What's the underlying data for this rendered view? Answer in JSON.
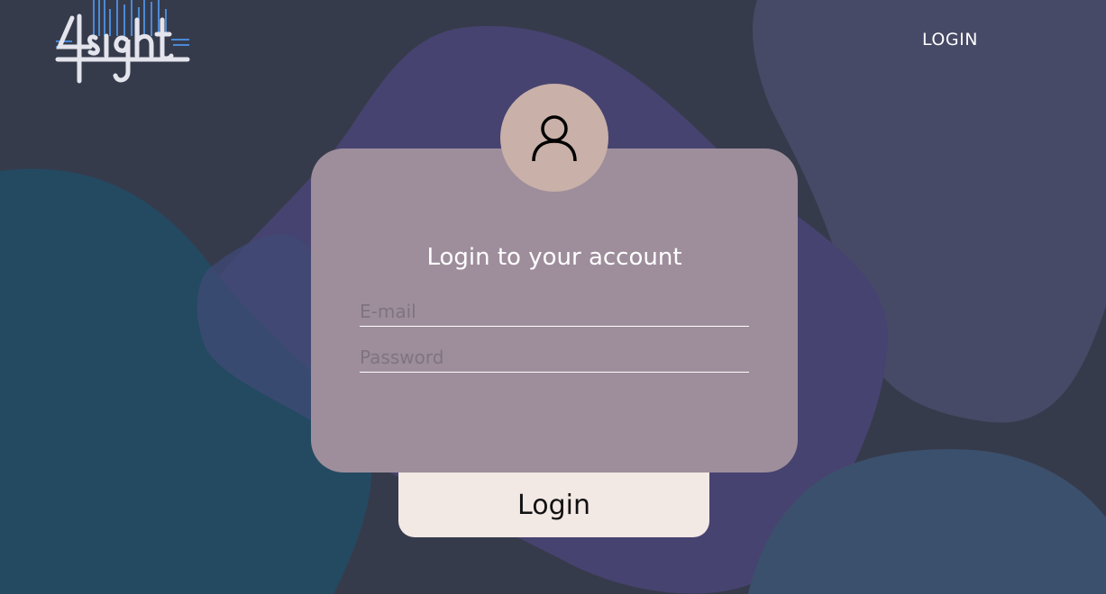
{
  "brand": {
    "logo_text": "4sight",
    "colors": {
      "background": "#363b4c",
      "card": "#9e8e9c",
      "avatar": "#c9b0a8",
      "button": "#f2e8e4",
      "logo_accent": "#4a8ad6"
    }
  },
  "nav": {
    "login_label": "LOGIN"
  },
  "card": {
    "avatar_icon": "user-icon",
    "title": "Login to your account",
    "email_placeholder": "E-mail",
    "password_placeholder": "Password"
  },
  "login_button": {
    "label": "Login"
  }
}
